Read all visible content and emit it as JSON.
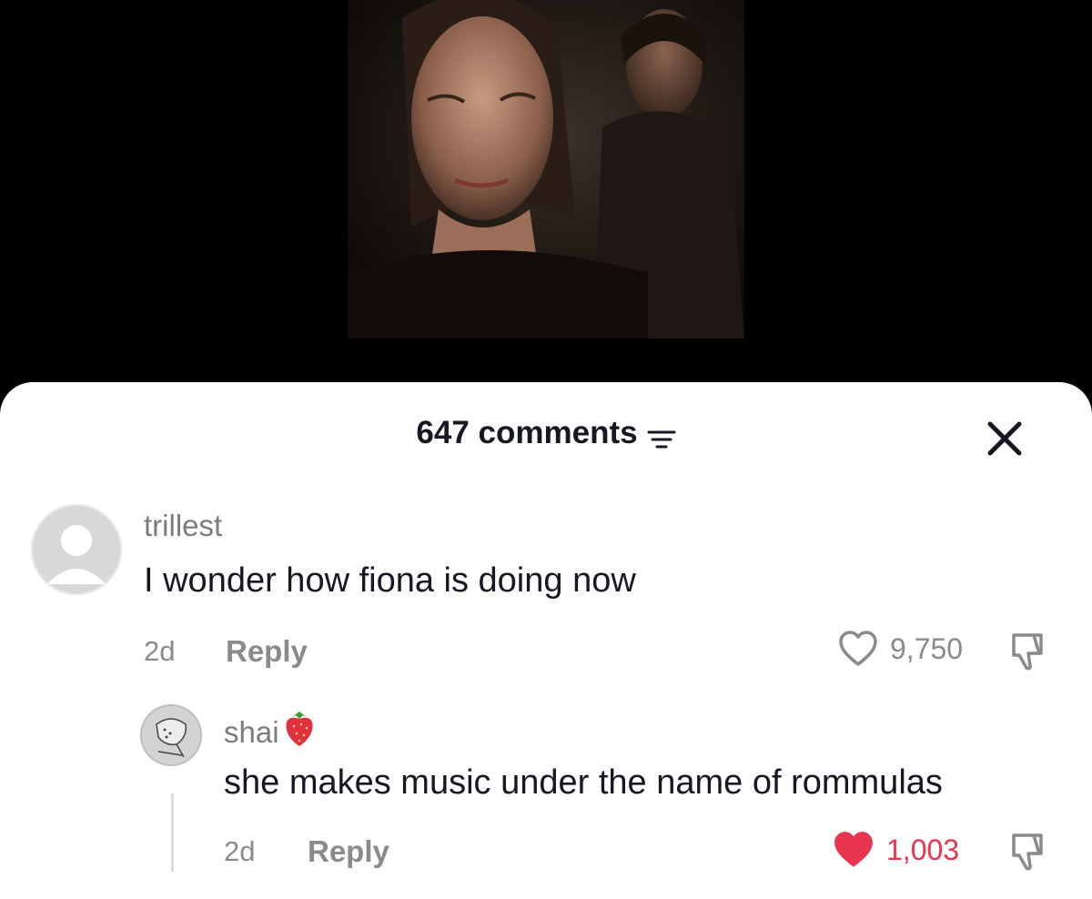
{
  "video": {
    "description_icon": "video-thumbnail"
  },
  "sheet": {
    "comment_count_label": "647 comments",
    "sort_icon": "filter-lines-icon",
    "close_icon": "close-icon"
  },
  "comments": [
    {
      "username": "trillest",
      "text": "I wonder how fiona is doing now",
      "time": "2d",
      "reply_label": "Reply",
      "likes": "9,750",
      "liked": false,
      "avatar_icon": "default-avatar-icon"
    },
    {
      "username": "shai",
      "username_emoji": "strawberry-emoji",
      "text": "she makes music under the name of rommulas",
      "time": "2d",
      "reply_label": "Reply",
      "likes": "1,003",
      "liked": true,
      "avatar_icon": "drawn-avatar-icon"
    }
  ],
  "colors": {
    "like_active": "#fe2c55",
    "muted": "#8a8a8a",
    "text": "#161823"
  }
}
